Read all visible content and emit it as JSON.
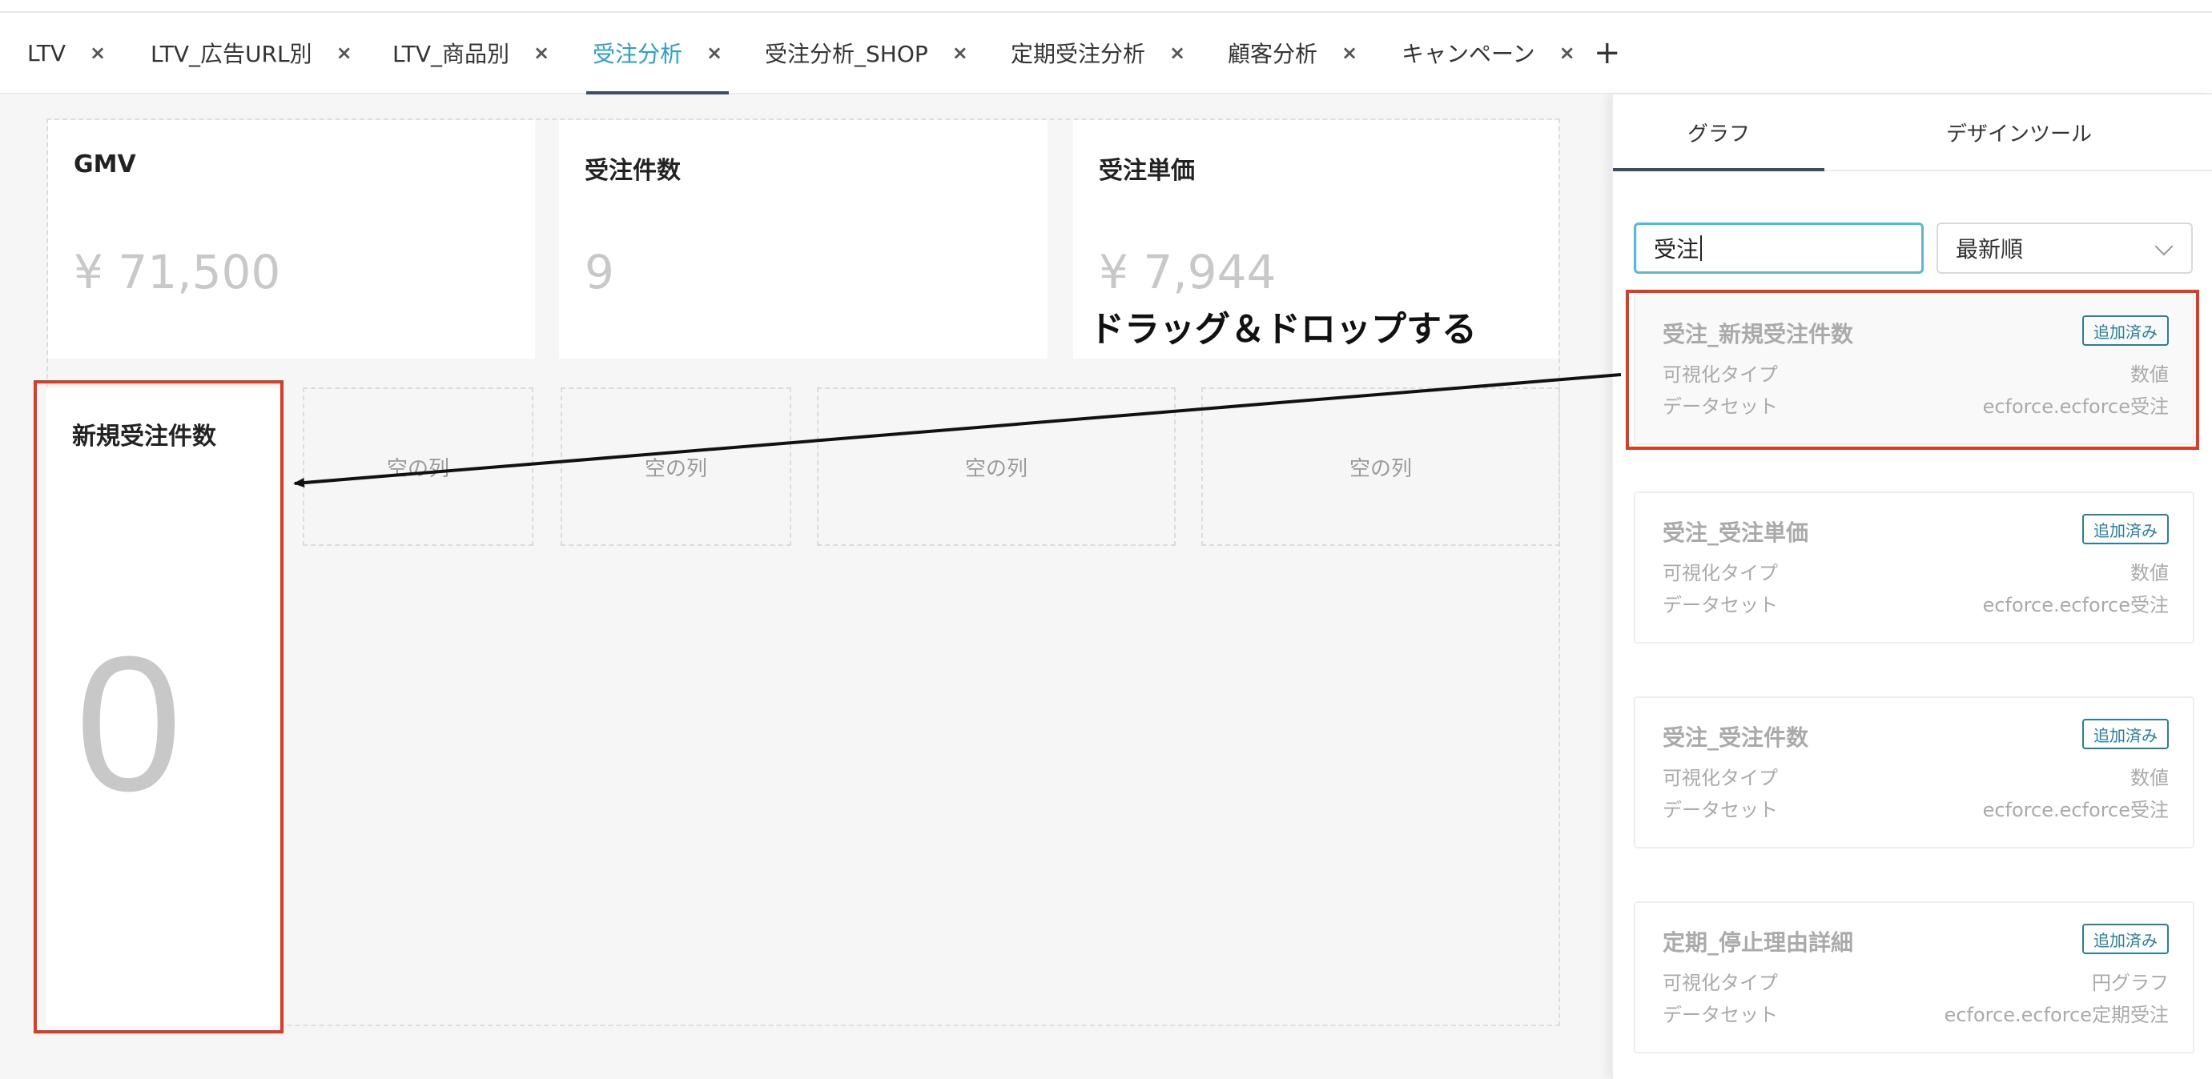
{
  "tabs": [
    {
      "label": "LTV"
    },
    {
      "label": "LTV_広告URL別"
    },
    {
      "label": "LTV_商品別"
    },
    {
      "label": "受注分析"
    },
    {
      "label": "受注分析_SHOP"
    },
    {
      "label": "定期受注分析"
    },
    {
      "label": "顧客分析"
    },
    {
      "label": "キャンペーン"
    }
  ],
  "active_tab": "受注分析",
  "tab_close_glyph": "×",
  "tab_add_glyph": "+",
  "cards": [
    {
      "title": "GMV",
      "value": "¥ 71,500"
    },
    {
      "title": "受注件数",
      "value": "9"
    },
    {
      "title": "受注単価",
      "value": "¥ 7,944"
    }
  ],
  "empty_col_label": "空の列",
  "new_card": {
    "title": "新規受注件数",
    "value": "0"
  },
  "drag_label": "ドラッグ＆ドロップする",
  "panel": {
    "tabs": [
      {
        "label": "グラフ"
      },
      {
        "label": "デザインツール"
      }
    ],
    "search_value": "受注",
    "sort_value": "最新順",
    "items": [
      {
        "name": "受注_新規受注件数",
        "badge": "追加済み",
        "type_label": "可視化タイプ",
        "type_value": "数値",
        "dataset_label": "データセット",
        "dataset_value": "ecforce.ecforce受注"
      },
      {
        "name": "受注_受注単価",
        "badge": "追加済み",
        "type_label": "可視化タイプ",
        "type_value": "数値",
        "dataset_label": "データセット",
        "dataset_value": "ecforce.ecforce受注"
      },
      {
        "name": "受注_受注件数",
        "badge": "追加済み",
        "type_label": "可視化タイプ",
        "type_value": "数値",
        "dataset_label": "データセット",
        "dataset_value": "ecforce.ecforce受注"
      },
      {
        "name": "定期_停止理由詳細",
        "badge": "追加済み",
        "type_label": "可視化タイプ",
        "type_value": "円グラフ",
        "dataset_label": "データセット",
        "dataset_value": "ecforce.ecforce定期受注"
      }
    ]
  },
  "colors": {
    "accent": "#2aa0c8",
    "annotation": "#e03a22",
    "tab_underline": "#3e4a6b"
  }
}
